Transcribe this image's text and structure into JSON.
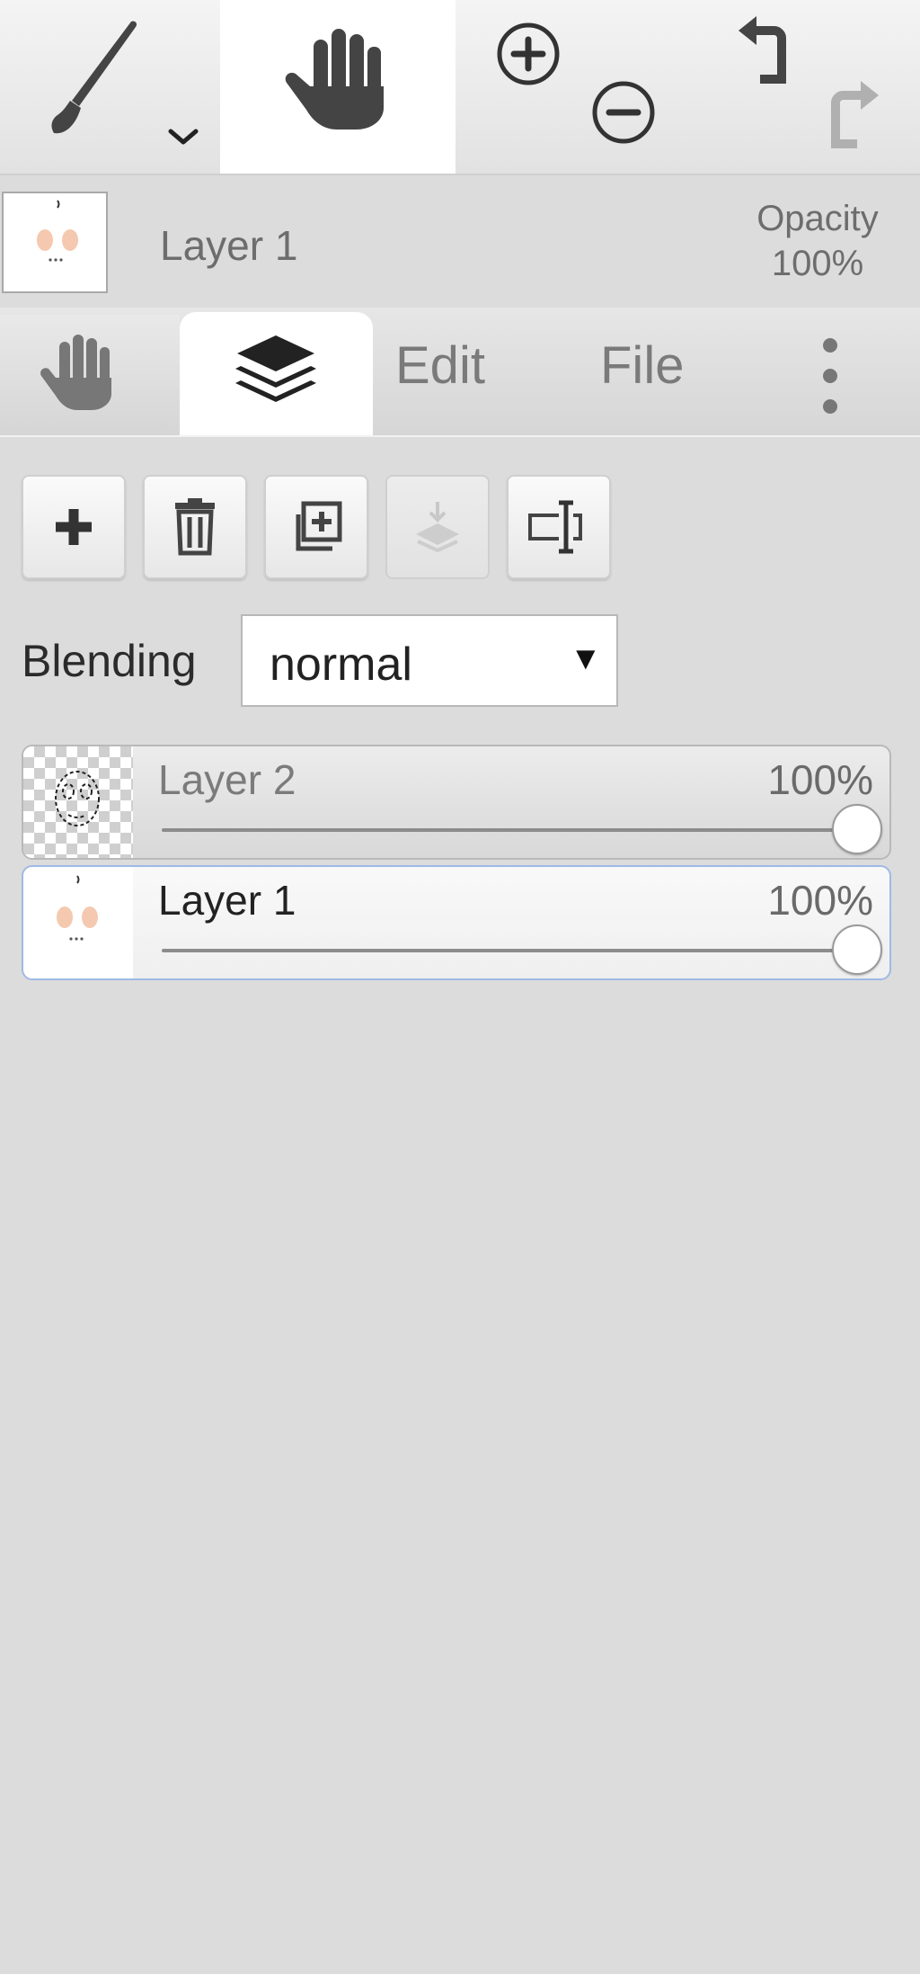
{
  "toolbar": {
    "tools": [
      "brush-tool",
      "hand-tool"
    ],
    "selected_tool": "hand-tool",
    "icons": [
      "brush-icon",
      "chevron-down-icon",
      "hand-icon",
      "zoom-in-icon",
      "zoom-out-icon",
      "undo-icon",
      "redo-icon"
    ]
  },
  "current_layer": {
    "name": "Layer 1",
    "opacity_label": "Opacity",
    "opacity_value": "100%"
  },
  "tabs": [
    {
      "name": "hand-tab",
      "icon": "hand-icon"
    },
    {
      "name": "layers-tab",
      "icon": "layers-icon",
      "active": true
    },
    {
      "label": "Edit"
    },
    {
      "label": "File"
    },
    {
      "name": "more-tab",
      "icon": "more-vertical-icon"
    }
  ],
  "layer_actions": [
    {
      "icon": "plus-icon",
      "enabled": true
    },
    {
      "icon": "trash-icon",
      "enabled": true
    },
    {
      "icon": "duplicate-icon",
      "enabled": true
    },
    {
      "icon": "merge-down-icon",
      "enabled": false
    },
    {
      "icon": "rename-icon",
      "enabled": true
    }
  ],
  "blending": {
    "label": "Blending",
    "value": "normal",
    "arrow": "▼"
  },
  "layers": [
    {
      "name": "Layer 2",
      "opacity": "100%",
      "opacity_fraction": 1.0,
      "selected": false
    },
    {
      "name": "Layer 1",
      "opacity": "100%",
      "opacity_fraction": 1.0,
      "selected": true
    }
  ],
  "colors": {
    "background": "#dcdcdc",
    "selected_border": "#9fb9e6",
    "icon": "#3a3a3a"
  }
}
